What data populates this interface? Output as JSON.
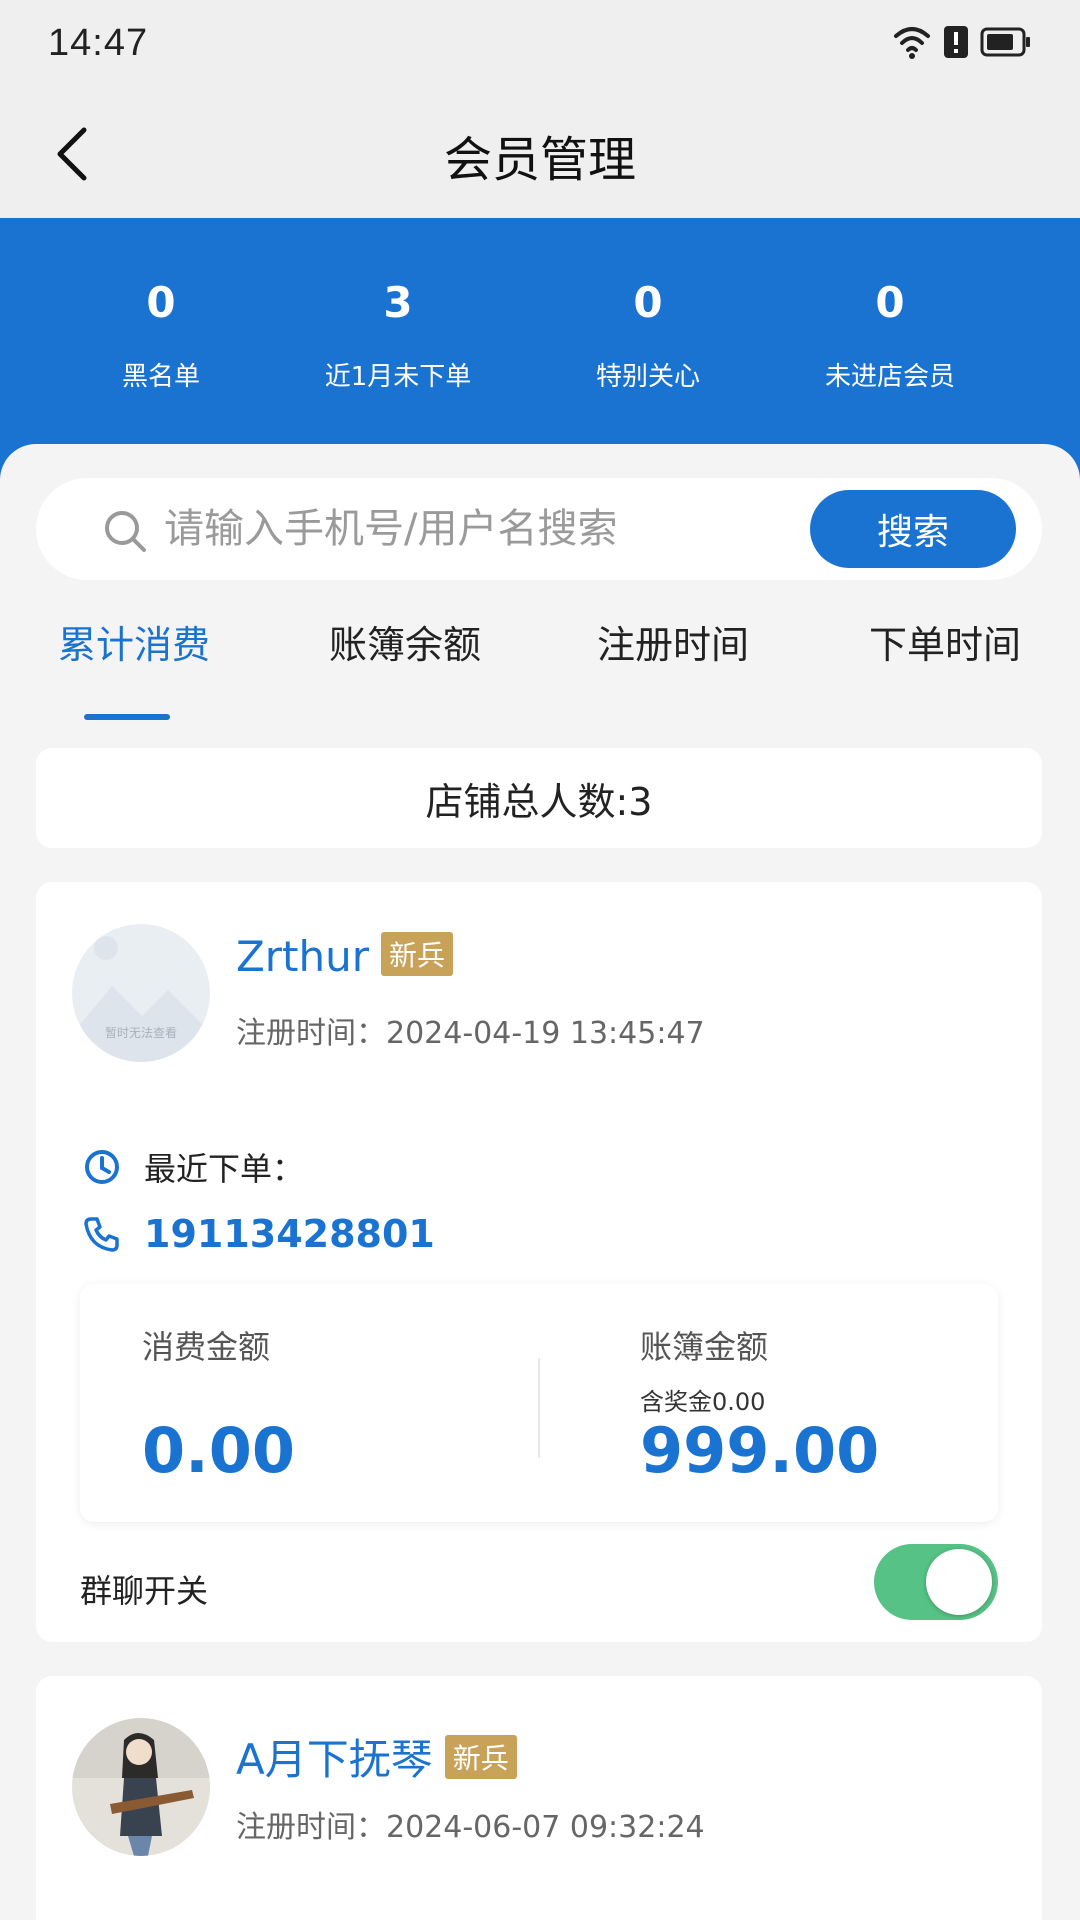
{
  "status_bar": {
    "time": "14:47",
    "icons": [
      "wifi-icon",
      "alert-icon",
      "battery-icon"
    ]
  },
  "nav": {
    "title": "会员管理",
    "back_icon": "chevron-left-icon"
  },
  "stats": [
    {
      "value": "0",
      "label": "黑名单"
    },
    {
      "value": "3",
      "label": "近1月未下单"
    },
    {
      "value": "0",
      "label": "特别关心"
    },
    {
      "value": "0",
      "label": "未进店会员"
    }
  ],
  "search": {
    "placeholder": "请输入手机号/用户名搜索",
    "value": "",
    "button_label": "搜索"
  },
  "tabs": [
    {
      "label": "累计消费",
      "active": true
    },
    {
      "label": "账簿余额",
      "active": false
    },
    {
      "label": "注册时间",
      "active": false
    },
    {
      "label": "下单时间",
      "active": false
    }
  ],
  "store_total": "店铺总人数:3",
  "members": [
    {
      "name": "Zrthur",
      "badge": "新兵",
      "register_time": "注册时间：2024-04-19 13:45:47",
      "avatar_watermark": "暂时无法查看",
      "recent_order_label": "最近下单：",
      "phone": "19113428801",
      "consume_label": "消费金额",
      "consume_amount": "0.00",
      "ledger_label": "账簿金额",
      "ledger_sub": "含奖金0.00",
      "ledger_amount": "999.00",
      "group_chat_label": "群聊开关",
      "group_chat_on": true
    },
    {
      "name": "A月下抚琴",
      "badge": "新兵",
      "register_time": "注册时间：2024-06-07 09:32:24"
    }
  ],
  "colors": {
    "primary": "#1a73d1",
    "badge": "#c9a25a",
    "toggle_on": "#56c285",
    "background": "#f4f4f4"
  }
}
